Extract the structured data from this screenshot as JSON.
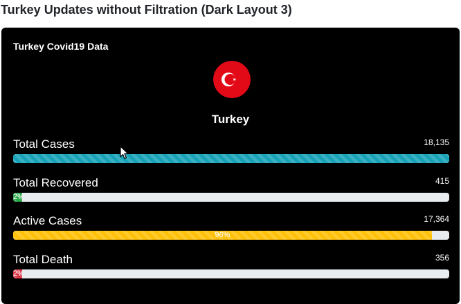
{
  "page": {
    "heading": "Turkey Updates without Filtration (Dark Layout 3)"
  },
  "card": {
    "title": "Turkey Covid19 Data",
    "country": "Turkey",
    "flag_icon": "turkey-flag-icon",
    "colors": {
      "background": "#000000",
      "flag_red": "#e30a17"
    }
  },
  "stats": [
    {
      "label": "Total Cases",
      "value": "18,135",
      "progress_percent": 100,
      "bar_text": "",
      "color": "#17a2b8"
    },
    {
      "label": "Total Recovered",
      "value": "415",
      "progress_percent": 2,
      "bar_text": "2%",
      "color": "#28a745"
    },
    {
      "label": "Active Cases",
      "value": "17,364",
      "progress_percent": 96,
      "bar_text": "96%",
      "color": "#ffc107"
    },
    {
      "label": "Total Death",
      "value": "356",
      "progress_percent": 2,
      "bar_text": "2%",
      "color": "#dc3545"
    }
  ]
}
